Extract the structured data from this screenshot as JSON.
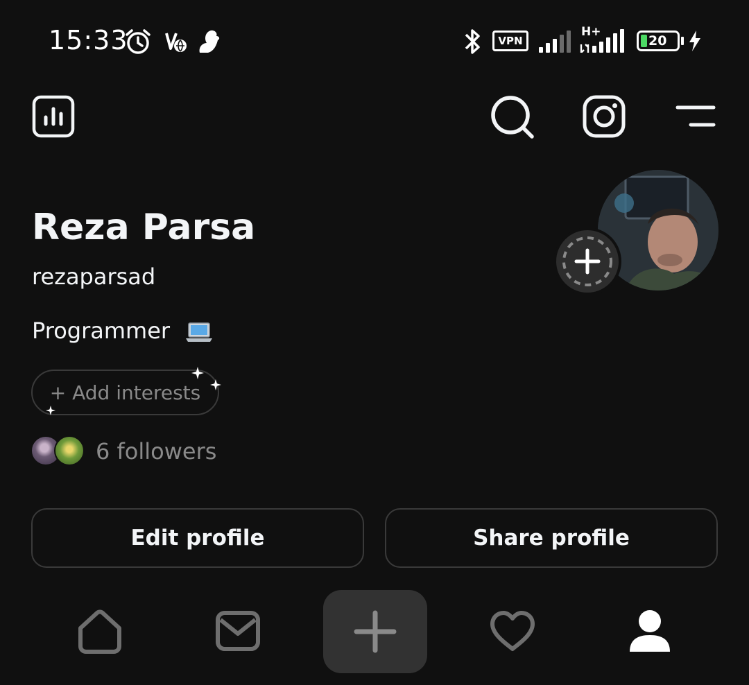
{
  "status_bar": {
    "time": "15:33",
    "vpn_label": "VPN",
    "network_label": "H+",
    "battery_percent": "20",
    "icons": [
      "alarm-icon",
      "volte-icon",
      "squirrel-icon",
      "bluetooth-icon",
      "signal-icon",
      "signal-icon",
      "battery-icon",
      "charging-icon"
    ]
  },
  "header": {
    "icons": [
      "insights-icon",
      "search-icon",
      "instagram-icon",
      "menu-icon"
    ]
  },
  "profile": {
    "display_name": "Reza Parsa",
    "username": "rezaparsad",
    "bio": "Programmer",
    "bio_emoji": "laptop-icon",
    "add_interests": "+ Add interests",
    "followers": "6 followers"
  },
  "actions": {
    "edit_profile": "Edit profile",
    "share_profile": "Share profile"
  },
  "bottom_nav": {
    "items": [
      "home-icon",
      "inbox-icon",
      "create-icon",
      "activity-icon",
      "profile-icon"
    ],
    "active": "profile-icon"
  },
  "colors": {
    "background": "#101010",
    "text": "#f3f5f7",
    "muted_text": "#8a8a8a",
    "border": "#3a3a3a",
    "create_button": "#323232",
    "battery_fill": "#4cd964"
  }
}
